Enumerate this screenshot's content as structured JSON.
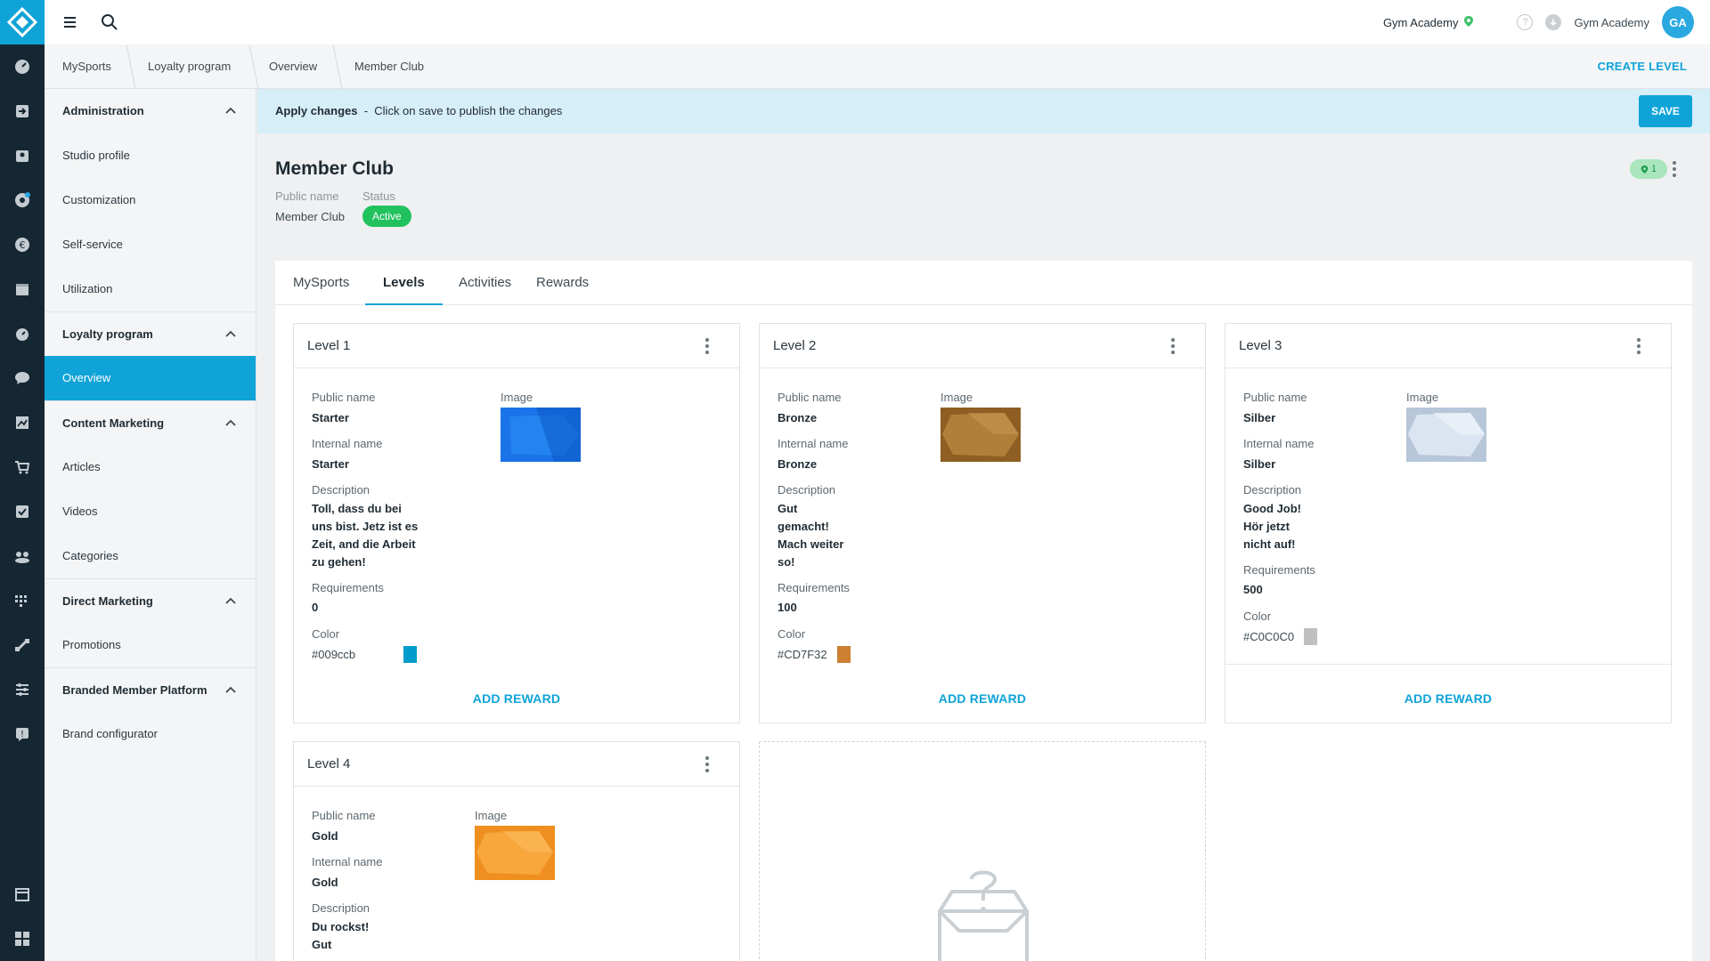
{
  "app": {
    "org_name": "Gym Academy",
    "user_name": "Gym Academy",
    "avatar_initials": "GA"
  },
  "breadcrumb": [
    "MySports",
    "Loyalty program",
    "Overview",
    "Member Club"
  ],
  "header": {
    "create_level_label": "CREATE LEVEL"
  },
  "sidebar": {
    "sections": [
      {
        "title": "Administration",
        "items": [
          "Studio profile",
          "Customization",
          "Self-service",
          "Utilization"
        ]
      },
      {
        "title": "Loyalty program",
        "items": [
          "Overview"
        ],
        "active_item": "Overview"
      },
      {
        "title": "Content Marketing",
        "items": [
          "Articles",
          "Videos",
          "Categories"
        ]
      },
      {
        "title": "Direct Marketing",
        "items": [
          "Promotions"
        ]
      },
      {
        "title": "Branded Member Platform",
        "items": [
          "Brand configurator"
        ]
      }
    ]
  },
  "banner": {
    "title": "Apply changes",
    "separator": "-",
    "message": "Click on save to publish the changes",
    "save_label": "SAVE"
  },
  "page": {
    "title": "Member Club",
    "public_name_label": "Public name",
    "public_name": "Member Club",
    "status_label": "Status",
    "status": "Active",
    "location_badge_count": "1"
  },
  "tabs": [
    "MySports",
    "Levels",
    "Activities",
    "Rewards"
  ],
  "active_tab": "Levels",
  "labels": {
    "public_name": "Public name",
    "image": "Image",
    "internal_name": "Internal name",
    "description": "Description",
    "requirements": "Requirements",
    "color": "Color",
    "add_reward": "ADD REWARD"
  },
  "levels": [
    {
      "title": "Level 1",
      "public_name": "Starter",
      "internal_name": "Starter",
      "description_lines": [
        "Toll, dass du bei",
        "uns bist. Jetz ist es",
        "Zeit, and die Arbeit",
        "zu gehen!"
      ],
      "requirements": "0",
      "color": "#009ccb",
      "image_color": "#1a73e8"
    },
    {
      "title": "Level 2",
      "public_name": "Bronze",
      "internal_name": "Bronze",
      "description_lines": [
        "Gut",
        "gemacht!",
        "Mach weiter",
        "so!"
      ],
      "requirements": "100",
      "color": "#CD7F32",
      "image_color": "#a8732e"
    },
    {
      "title": "Level 3",
      "public_name": "Silber",
      "internal_name": "Silber",
      "description_lines": [
        "Good Job!",
        "Hör jetzt",
        "nicht auf!"
      ],
      "requirements": "500",
      "color": "#C0C0C0",
      "image_color": "#c9d6e6"
    },
    {
      "title": "Level 4",
      "public_name": "Gold",
      "internal_name": "Gold",
      "description_lines": [
        "Du rockst!",
        "Gut"
      ],
      "image_color": "#f5a030"
    }
  ],
  "colors": {
    "accent": "#0fa3d8",
    "rail": "#152733",
    "status_active": "#21c25e",
    "banner_bg": "#d6eef8"
  }
}
